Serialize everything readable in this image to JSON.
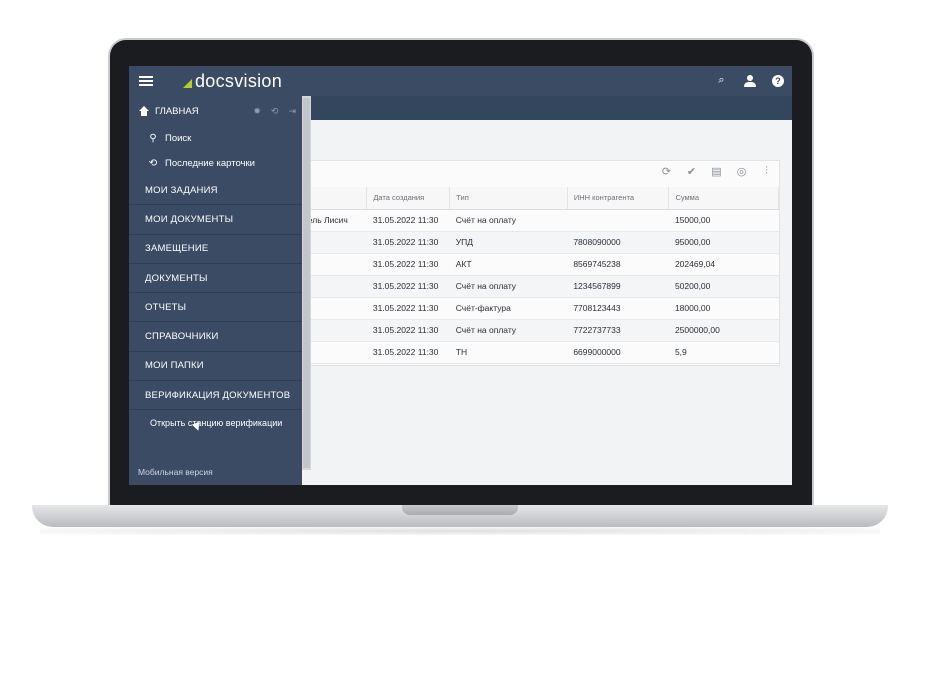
{
  "app": {
    "logo_text": "docsvision"
  },
  "icons": {
    "search": "search-icon",
    "user": "user-icon",
    "help": "help-icon",
    "help_glyph": "?",
    "search_glyph": "⌕"
  },
  "sidebar": {
    "home_label": "ГЛАВНАЯ",
    "search_label": "Поиск",
    "recent_label": "Последние карточки",
    "items": [
      {
        "label": "МОИ ЗАДАНИЯ"
      },
      {
        "label": "МОИ ДОКУМЕНТЫ"
      },
      {
        "label": "ЗАМЕЩЕНИЕ"
      },
      {
        "label": "ДОКУМЕНТЫ"
      },
      {
        "label": "ОТЧЕТЫ"
      },
      {
        "label": "СПРАВОЧНИКИ"
      },
      {
        "label": "МОИ ПАПКИ"
      },
      {
        "label": "ВЕРИФИКАЦИЯ ДОКУМЕНТОВ"
      }
    ],
    "open_station_label": "Открыть станцию верификации",
    "mobile_label": "Мобильная версия"
  },
  "table": {
    "headers": [
      "",
      "Дата создания",
      "Тип",
      "ИНН контрагента",
      "Сумма"
    ],
    "rows": [
      [
        "тель Лисич",
        "31.05.2022 11:30",
        "Счёт на оплату",
        "",
        "15000,00"
      ],
      [
        "",
        "31.05.2022 11:30",
        "УПД",
        "7808090000",
        "95000,00"
      ],
      [
        "",
        "31.05.2022 11:30",
        "АКТ",
        "8569745238",
        "202469,04"
      ],
      [
        "",
        "31.05.2022 11:30",
        "Счёт на оплату",
        "1234567899",
        "50200,00"
      ],
      [
        "",
        "31.05.2022 11:30",
        "Счёт-фактура",
        "7708123443",
        "18000,00"
      ],
      [
        "",
        "31.05.2022 11:30",
        "Счёт на оплату",
        "7722737733",
        "2500000,00"
      ],
      [
        "",
        "31.05.2022 11:30",
        "ТН",
        "6699000000",
        "5,9"
      ]
    ]
  },
  "colors": {
    "brand_accent": "#b6cf2b",
    "sidebar_bg": "#3a4b63"
  }
}
